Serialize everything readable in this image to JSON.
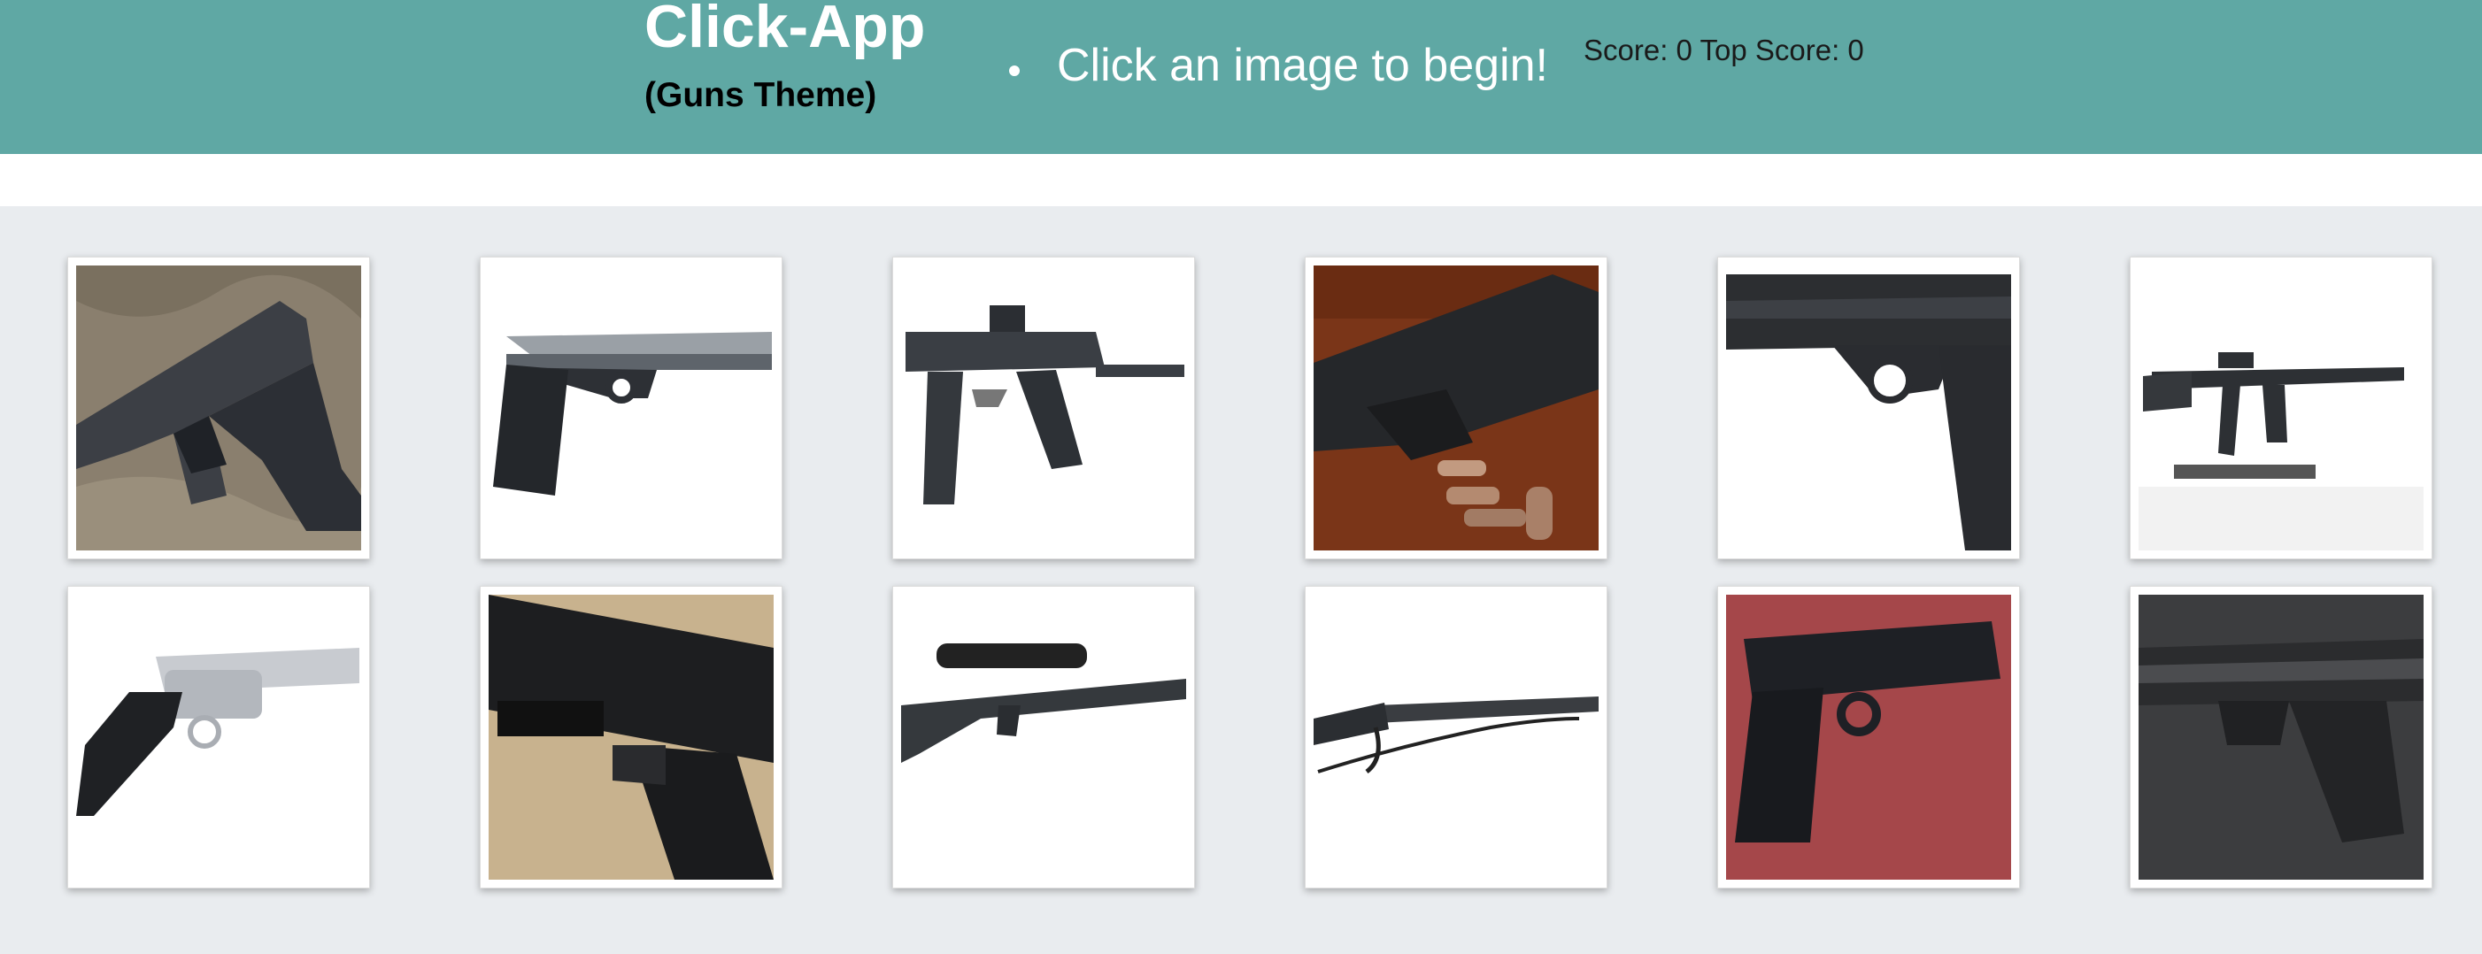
{
  "navbar": {
    "title": "Click-App",
    "subtitle": "(Guns Theme)",
    "message": "Click an image to begin!",
    "score_label": "Score:",
    "score": "0",
    "top_score_label": "Top Score:",
    "top_score": "0",
    "background_color": "#5fa8a4"
  },
  "game": {
    "background_color": "#e9ecef",
    "cards": [
      {
        "id": "card-1",
        "subject": "semi-automatic pistol on fabric"
      },
      {
        "id": "card-2",
        "subject": "1911-style pistol"
      },
      {
        "id": "card-3",
        "subject": "pistol-caliber carbine with optic"
      },
      {
        "id": "card-4",
        "subject": "pistol with cartridges on wood"
      },
      {
        "id": "card-5",
        "subject": "pistol close-up"
      },
      {
        "id": "card-6",
        "subject": "AR-style rifle on stand"
      },
      {
        "id": "card-7",
        "subject": "stainless revolver"
      },
      {
        "id": "card-8",
        "subject": "pistol with light on carpet"
      },
      {
        "id": "card-9",
        "subject": "scoped rifle"
      },
      {
        "id": "card-10",
        "subject": "lever-action rifle with sling"
      },
      {
        "id": "card-11",
        "subject": "pistol on red background"
      },
      {
        "id": "card-12",
        "subject": "pistol on dark background"
      }
    ]
  }
}
